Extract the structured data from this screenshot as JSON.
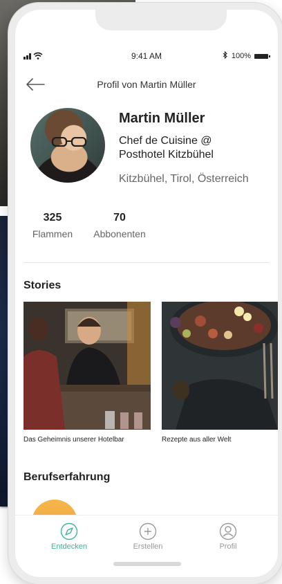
{
  "status_bar": {
    "time": "9:41 AM",
    "battery": "100%"
  },
  "nav": {
    "title": "Profil von Martin Müller",
    "back_icon": "arrow-left-icon"
  },
  "profile": {
    "name": "Martin Müller",
    "role": "Chef de Cuisine @ Posthotel Kitzbühel",
    "location": "Kitzbühel, Tirol, Österreich"
  },
  "stats": [
    {
      "value": "325",
      "label": "Flammen"
    },
    {
      "value": "70",
      "label": "Abbonenten"
    }
  ],
  "sections": {
    "stories": "Stories",
    "work": "Berufserfahrung"
  },
  "stories": [
    {
      "caption": "Das Geheimnis unserer Hotelbar"
    },
    {
      "caption": "Rezepte aus aller Welt"
    }
  ],
  "tabbar": [
    {
      "label": "Entdecken",
      "icon": "compass-icon",
      "active": true
    },
    {
      "label": "Erstellen",
      "icon": "plus-circle-icon",
      "active": false
    },
    {
      "label": "Profil",
      "icon": "user-icon",
      "active": false
    }
  ],
  "colors": {
    "accent": "#3ab49a",
    "inactive": "#999999",
    "work_badge": "#f2a93e"
  }
}
